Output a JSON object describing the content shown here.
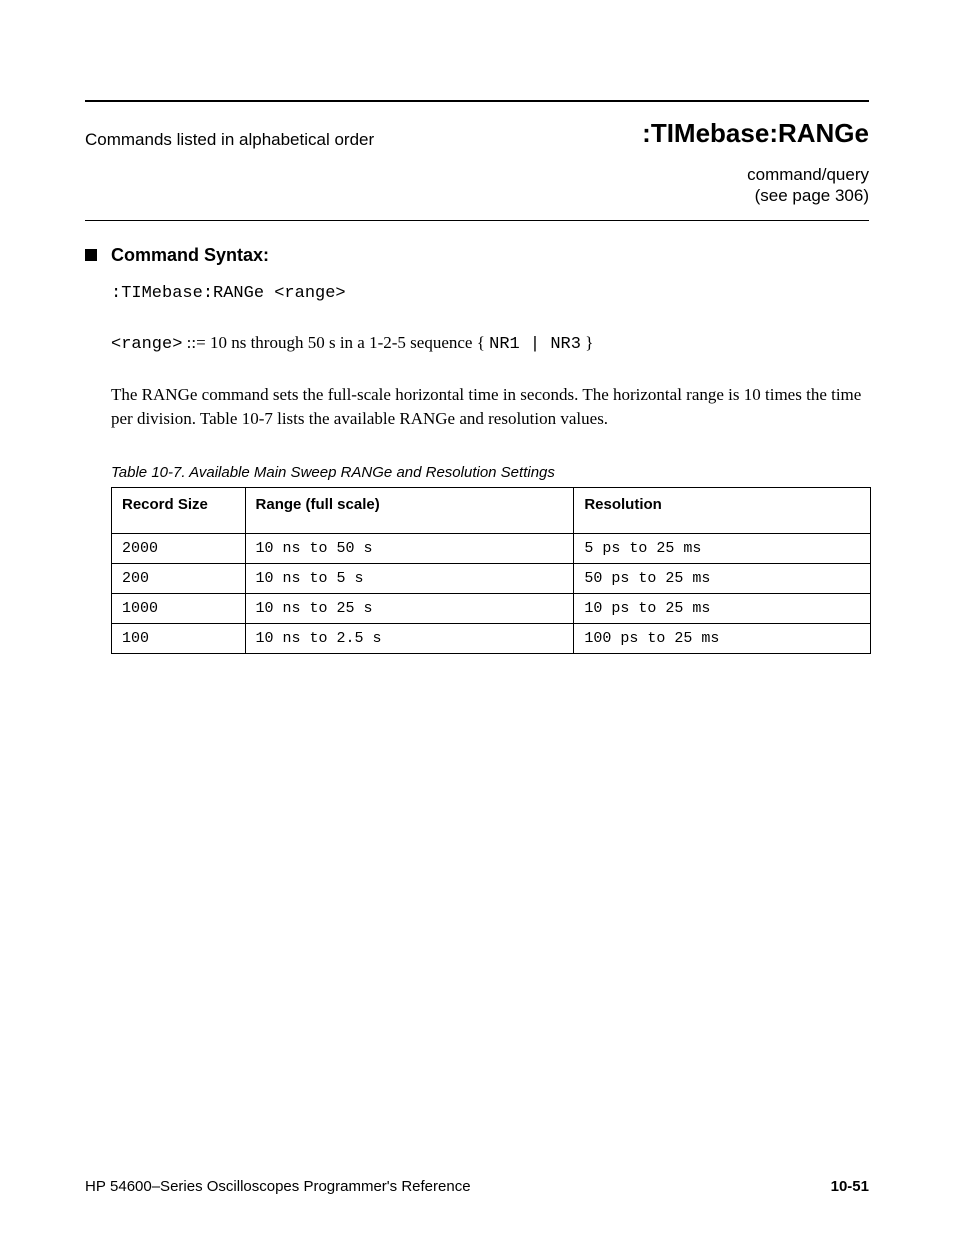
{
  "header": {
    "left_title": "Commands listed in alphabetical order",
    "command": ":TIMebase:RANGe",
    "sub_line1": "command/query",
    "sub_line2": "(see page 306)"
  },
  "section": {
    "title": "Command Syntax:",
    "syntax_line": ":TIMebase:RANGe <range>",
    "arg_label": "<range>",
    "arg_label_suffix": " ::= 10 ns through 50 s in a 1‑2‑5 sequence {",
    "types": "NR1 | NR3",
    "arg_label_close": "}",
    "para": "The RANGe command sets the full‑scale horizontal time in seconds.  The horizontal range is 10 times the time per division.  Table 10-7 lists the available RANGe and resolution values.",
    "table_caption": "Table 10-7. Available Main Sweep RANGe and Resolution Settings",
    "table": {
      "headers": [
        "Record Size",
        "Range (full scale)",
        "Resolution"
      ],
      "rows": [
        [
          "2000",
          "10 ns to 50 s",
          "5 ps to 25 ms"
        ],
        [
          "200",
          "10 ns to 5 s",
          "50 ps to 25 ms"
        ],
        [
          "1000",
          "10 ns to 25 s",
          "10 ps to 25 ms"
        ],
        [
          "100",
          "10 ns to 2.5 s",
          "100 ps to 25 ms"
        ]
      ]
    }
  },
  "footer": {
    "page": "10‑51",
    "doc_title": "HP 54600–Series Oscilloscopes Programmer's Reference"
  }
}
